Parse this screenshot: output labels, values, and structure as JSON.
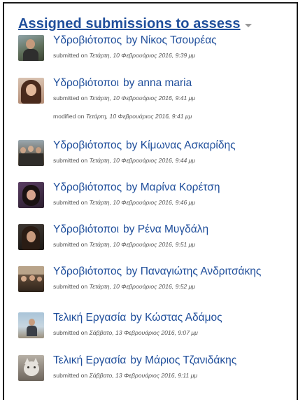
{
  "block": {
    "title": "Assigned submissions to assess"
  },
  "submissions": [
    {
      "title": "Υδροβιότοπος",
      "by": "by",
      "author": "Νίκος Τσουρέας",
      "meta_label": "submitted on",
      "meta_date": "Τετάρτη, 10 Φεβρουάριος 2016, 9:39 μμ",
      "modified_label": "",
      "modified_date": ""
    },
    {
      "title": "Υδροβιότοποι",
      "by": "by",
      "author": "anna maria",
      "meta_label": "submitted on",
      "meta_date": "Τετάρτη, 10 Φεβρουάριος 2016, 9:41 μμ",
      "modified_label": "modified on",
      "modified_date": "Τετάρτη, 10 Φεβρουάριος 2016, 9:41 μμ"
    },
    {
      "title": "Υδροβιότοπος",
      "by": "by",
      "author": "Κίμωνας Ασκαρίδης",
      "meta_label": "submitted on",
      "meta_date": "Τετάρτη, 10 Φεβρουάριος 2016, 9:44 μμ",
      "modified_label": "",
      "modified_date": ""
    },
    {
      "title": "Υδροβιότοπος",
      "by": "by",
      "author": "Μαρίνα Κορέτση",
      "meta_label": "submitted on",
      "meta_date": "Τετάρτη, 10 Φεβρουάριος 2016, 9:46 μμ",
      "modified_label": "",
      "modified_date": ""
    },
    {
      "title": "Υδροβιότοποι",
      "by": "by",
      "author": "Ρένα Μυγδάλη",
      "meta_label": "submitted on",
      "meta_date": "Τετάρτη, 10 Φεβρουάριος 2016, 9:51 μμ",
      "modified_label": "",
      "modified_date": ""
    },
    {
      "title": "Υδροβιότοπος",
      "by": "by",
      "author": "Παναγιώτης Ανδριτσάκης",
      "meta_label": "submitted on",
      "meta_date": "Τετάρτη, 10 Φεβρουάριος 2016, 9:52 μμ",
      "modified_label": "",
      "modified_date": ""
    },
    {
      "title": "Τελική Εργασία",
      "by": "by",
      "author": "Κώστας Αδάμος",
      "meta_label": "submitted on",
      "meta_date": "Σάββατο, 13 Φεβρουάριος 2016, 9:07 μμ",
      "modified_label": "",
      "modified_date": ""
    },
    {
      "title": "Τελική Εργασία",
      "by": "by",
      "author": "Μάριος Τζανιδάκης",
      "meta_label": "submitted on",
      "meta_date": "Σάββατο, 13 Φεβρουάριος 2016, 9:11 μμ",
      "modified_label": "",
      "modified_date": ""
    }
  ],
  "icons": {
    "collapse": "chevron-down-icon",
    "avatar": "user-photo-icon"
  },
  "colors": {
    "link": "#1f4e9b",
    "meta_text": "#555555",
    "toggle": "#9a9a9a"
  }
}
